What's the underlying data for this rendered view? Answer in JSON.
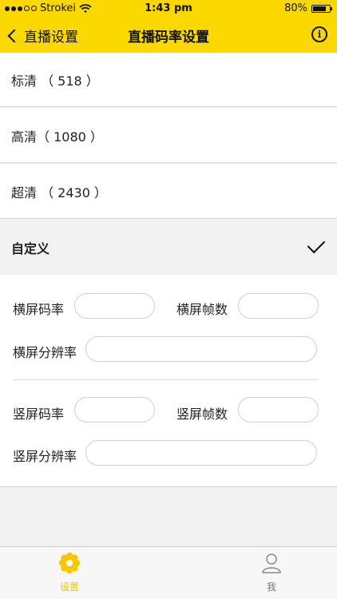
{
  "status_bar": {
    "carrier": "Strokei",
    "time": "1:43 pm",
    "battery": "80%",
    "battery_level": 0.8
  },
  "nav": {
    "back_label": "直播设置",
    "title": "直播码率设置",
    "info_icon": "info-icon"
  },
  "options": [
    {
      "label": "标清 （ 518 ）"
    },
    {
      "label": "高清（ 1080 ）"
    },
    {
      "label": "超清 （ 2430 ）"
    }
  ],
  "custom": {
    "label": "自定义",
    "selected": true,
    "landscape_bitrate_label": "横屏码率",
    "landscape_bitrate_value": "",
    "landscape_fps_label": "横屏帧数",
    "landscape_fps_value": "",
    "landscape_resolution_label": "横屏分辨率",
    "landscape_resolution_value": "",
    "portrait_bitrate_label": "竖屏码率",
    "portrait_bitrate_value": "",
    "portrait_fps_label": "竖屏帧数",
    "portrait_fps_value": "",
    "portrait_resolution_label": "竖屏分辨率",
    "portrait_resolution_value": ""
  },
  "tabbar": {
    "settings_label": "设置",
    "me_label": "我",
    "active_color": "#f0c300",
    "accent": "#fbd800"
  }
}
